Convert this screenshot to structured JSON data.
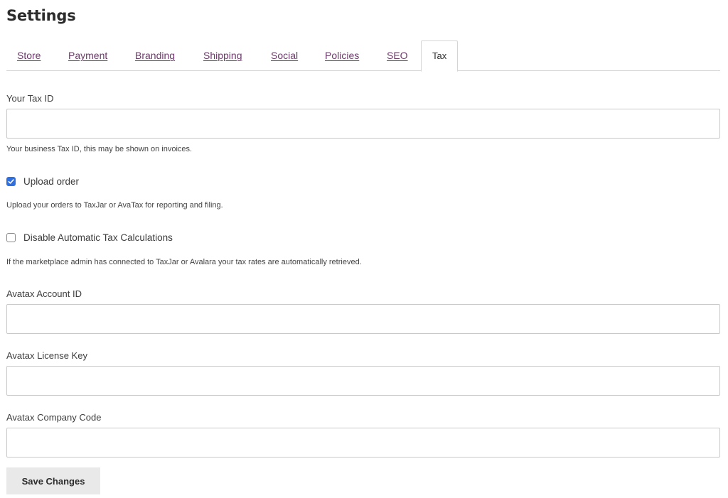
{
  "page": {
    "title": "Settings"
  },
  "tabs": [
    {
      "label": "Store",
      "active": false
    },
    {
      "label": "Payment",
      "active": false
    },
    {
      "label": "Branding",
      "active": false
    },
    {
      "label": "Shipping",
      "active": false
    },
    {
      "label": "Social",
      "active": false
    },
    {
      "label": "Policies",
      "active": false
    },
    {
      "label": "SEO",
      "active": false
    },
    {
      "label": "Tax",
      "active": true
    }
  ],
  "form": {
    "tax_id": {
      "label": "Your Tax ID",
      "value": "",
      "help": "Your business Tax ID, this may be shown on invoices."
    },
    "upload_order": {
      "label": "Upload order",
      "checked": true,
      "help": "Upload your orders to TaxJar or AvaTax for reporting and filing."
    },
    "disable_auto_tax": {
      "label": "Disable Automatic Tax Calculations",
      "checked": false,
      "help": "If the marketplace admin has connected to TaxJar or Avalara your tax rates are automatically retrieved."
    },
    "avatax_account_id": {
      "label": "Avatax Account ID",
      "value": ""
    },
    "avatax_license_key": {
      "label": "Avatax License Key",
      "value": ""
    },
    "avatax_company_code": {
      "label": "Avatax Company Code",
      "value": ""
    },
    "save_label": "Save Changes"
  },
  "colors": {
    "tab_link": "#6d3a6b",
    "checkbox_checked": "#2f6fe0",
    "button_bg": "#e9e9e9"
  },
  "icons": {
    "checkmark": "check-icon"
  }
}
